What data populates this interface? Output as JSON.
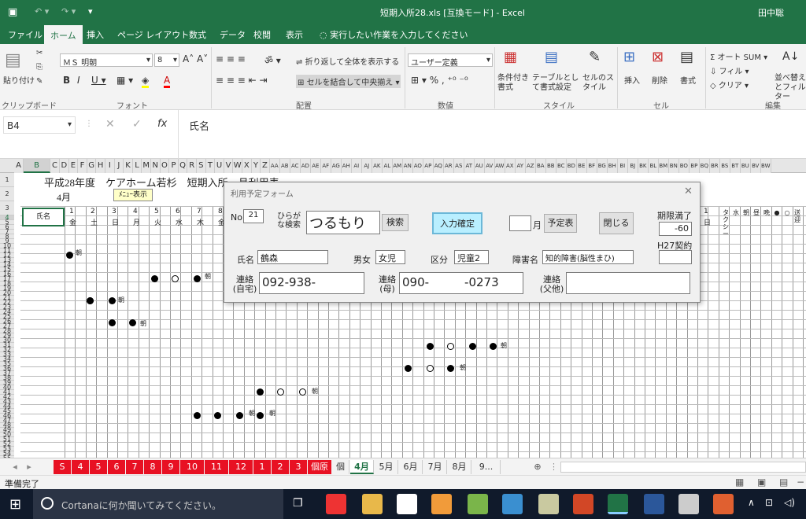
{
  "window": {
    "title": "短期入所28.xls [互換モード] - Excel",
    "user": "田中聡"
  },
  "tabs": [
    "ファイル",
    "ホーム",
    "挿入",
    "ページ レイアウト",
    "数式",
    "データ",
    "校閲",
    "表示"
  ],
  "tell_me": "実行したい作業を入力してください",
  "ribbon": {
    "paste": "貼り付け",
    "font_name": "ＭＳ 明朝",
    "font_size": "8",
    "wrap_text": "折り返して全体を表示する",
    "merge_center": "セルを結合して中央揃え",
    "number_format": "ユーザー定義",
    "cond_format": "条件付き書式",
    "table_format": "テーブルとして書式設定",
    "cell_styles": "セルのスタイル",
    "insert": "挿入",
    "delete": "削除",
    "format": "書式",
    "autosum": "オート SUM",
    "fill": "フィル",
    "clear": "クリア",
    "sort_filter": "並べ替えとフィルター",
    "groups": [
      "クリップボード",
      "フォント",
      "配置",
      "数値",
      "スタイル",
      "セル",
      "編集"
    ]
  },
  "formula": {
    "name_box": "B4",
    "content": "氏名"
  },
  "sheet": {
    "columns": [
      "A",
      "B",
      "C",
      "D",
      "E",
      "F",
      "G",
      "H",
      "I",
      "J",
      "K",
      "L",
      "M",
      "N",
      "O",
      "P",
      "Q",
      "R",
      "S",
      "T",
      "U",
      "V",
      "W",
      "X",
      "Y",
      "Z",
      "AA",
      "AB",
      "AC",
      "AD",
      "AE",
      "AF",
      "AG",
      "AH",
      "AI",
      "AJ",
      "AK",
      "AL",
      "AM",
      "AN",
      "AO",
      "AP",
      "AQ",
      "AR",
      "AS",
      "AT",
      "AU",
      "AV",
      "AW",
      "AX",
      "AY",
      "AZ",
      "BA",
      "BB",
      "BC",
      "BD",
      "BE",
      "BF",
      "BG",
      "BH",
      "BI",
      "BJ",
      "BK",
      "BL",
      "BM",
      "BN",
      "BO",
      "BP",
      "BQ",
      "BR",
      "BS",
      "BT",
      "BU",
      "BV",
      "BW"
    ],
    "title": "平成28年度　ケアホーム若杉　短期入所　月利用表",
    "month": "4月",
    "menu_button": "ﾒﾆｭｰ表示",
    "name_header": "氏名",
    "days": [
      {
        "d": "1",
        "w": "金"
      },
      {
        "d": "2",
        "w": "土"
      },
      {
        "d": "3",
        "w": "日"
      },
      {
        "d": "4",
        "w": "月"
      },
      {
        "d": "5",
        "w": "火"
      },
      {
        "d": "6",
        "w": "水"
      },
      {
        "d": "7",
        "w": "木"
      },
      {
        "d": "8",
        "w": "金"
      }
    ],
    "right_day": "1",
    "right_day_w": "日",
    "right_headers": [
      "タクシー",
      "水",
      "朝",
      "昼",
      "晩",
      "●",
      "○",
      "送迎"
    ],
    "mark_morning": "朝"
  },
  "dialog": {
    "title": "利用予定フォーム",
    "no_label": "No",
    "no_value": "21",
    "kana_label": "ひらがな検索",
    "kana_value": "つるもり",
    "search_btn": "検索",
    "confirm_btn": "入力確定",
    "month_label": "月",
    "schedule_btn": "予定表",
    "close_btn": "閉じる",
    "expiry_label": "期限満了",
    "expiry_value": "-60",
    "h27_label": "H27契約",
    "name_label": "氏名",
    "name_value": "鶴森",
    "sex_label": "男女",
    "sex_value": "女児",
    "category_label": "区分",
    "category_value": "児童2",
    "disability_label": "障害名",
    "disability_value": "知的障害(脳性まひ)",
    "home_label": "連絡(自宅)",
    "home_value": "092-938-",
    "mother_label": "連絡(母)",
    "mother_value": "090-　　　-0273",
    "other_label": "連絡(父他)",
    "other_value": ""
  },
  "sheet_tabs": [
    "S",
    "4",
    "5",
    "6",
    "7",
    "8",
    "9",
    "10",
    "11",
    "12",
    "1",
    "2",
    "3",
    "個原",
    "個",
    "4月",
    "5月",
    "6月",
    "7月",
    "8月",
    "9..."
  ],
  "status": "準備完了",
  "taskbar": {
    "cortana": "Cortanaに何か聞いてみてください。"
  },
  "colors": {
    "excel_green": "#217346",
    "red_tab": "#e81123",
    "dialog_button": "#b9efff"
  }
}
